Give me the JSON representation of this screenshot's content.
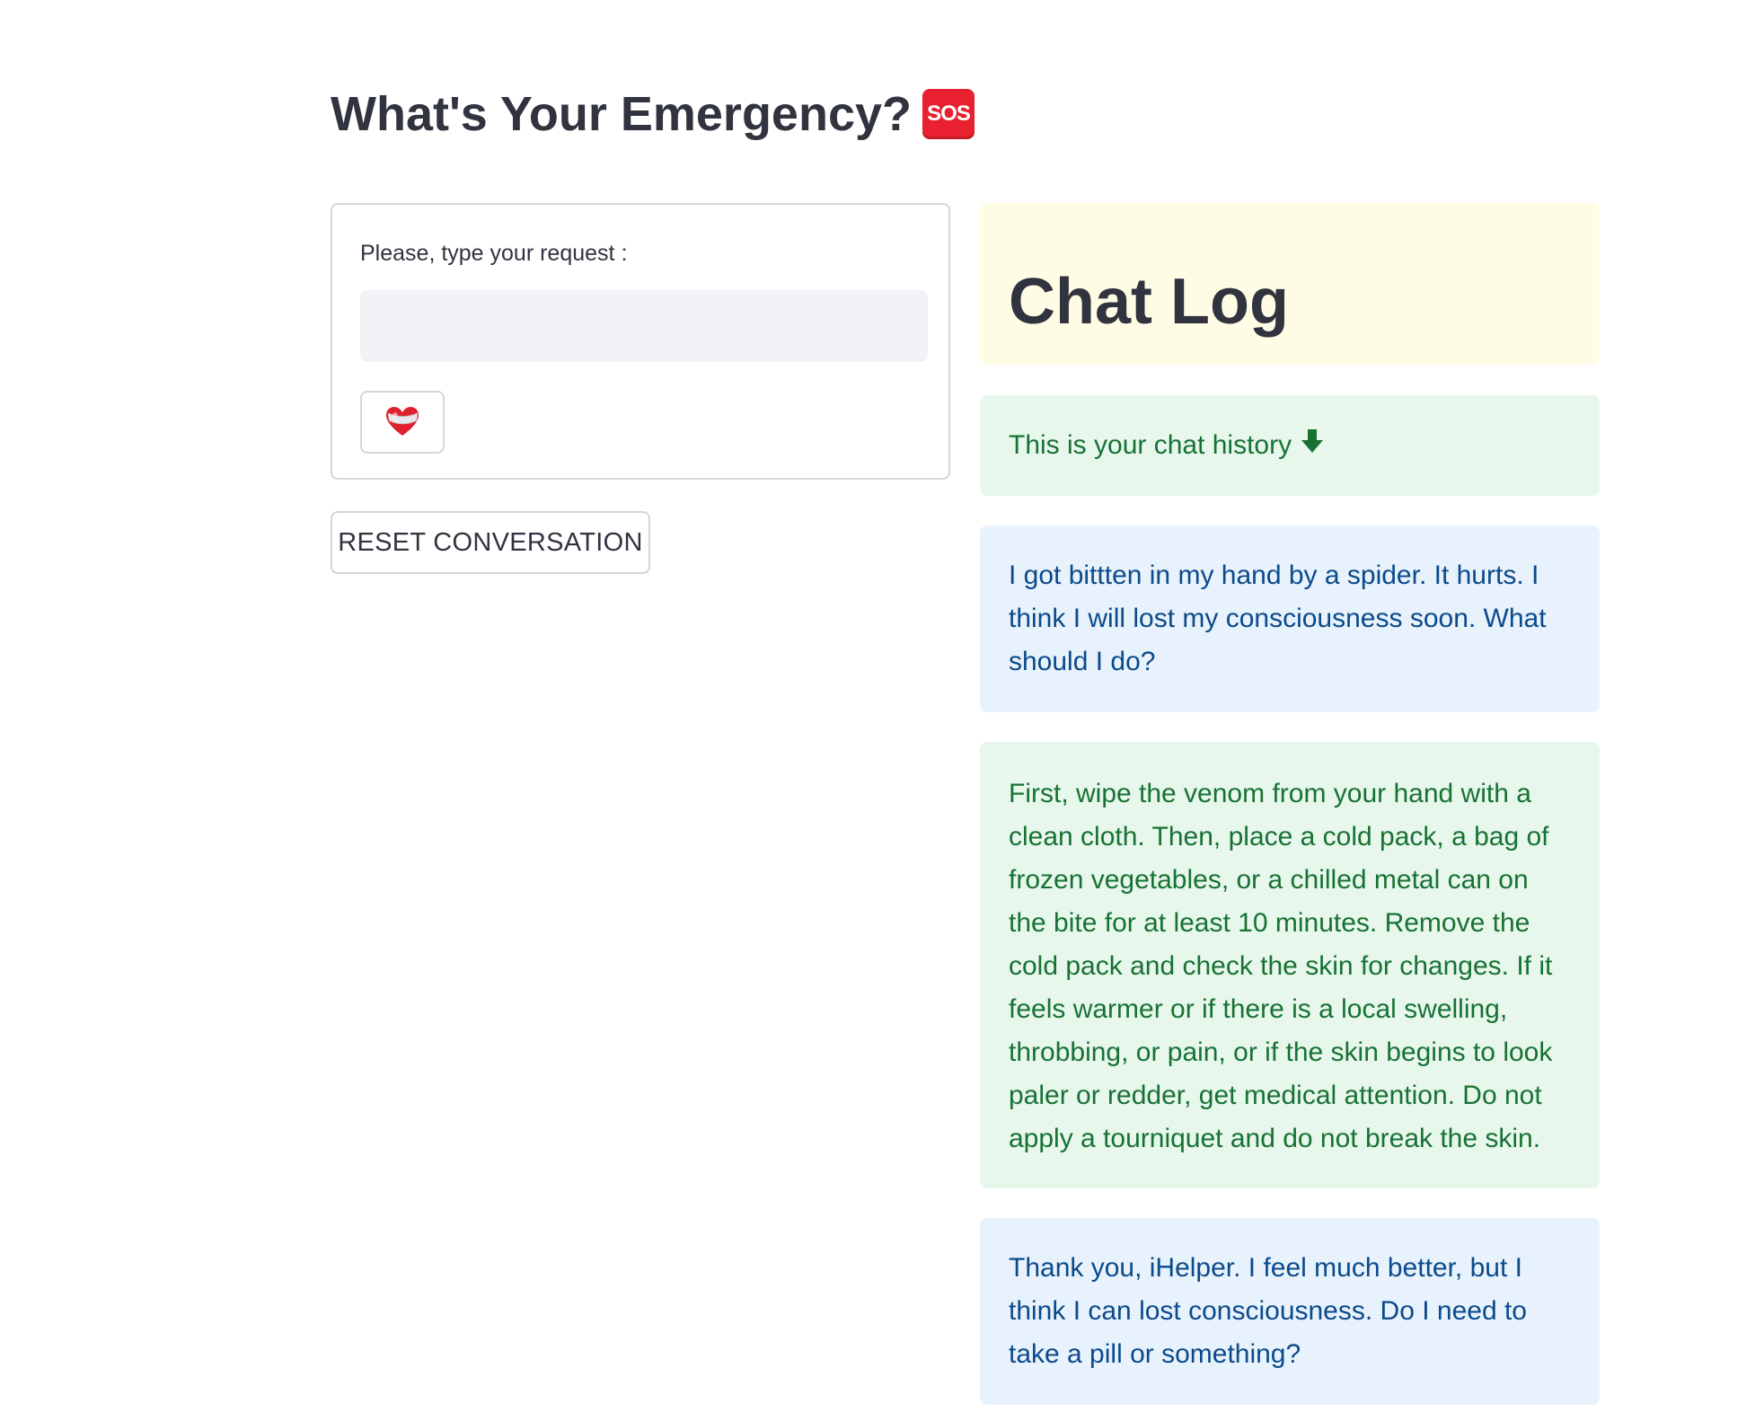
{
  "header": {
    "title": "What's Your Emergency?",
    "title_icon": "sos-icon",
    "title_icon_text": "SOS"
  },
  "form": {
    "label": "Please, type your request :",
    "input_value": "",
    "input_placeholder": "",
    "submit_icon": "mending-heart-icon"
  },
  "reset_button": {
    "label": "RESET CONVERSATION"
  },
  "chat_log": {
    "title": "Chat Log",
    "history_label": "This is your chat history",
    "history_icon": "down-arrow-icon",
    "messages": [
      {
        "role": "user",
        "text": "I got bittten in my hand by a spider. It hurts. I think I will lost my consciousness soon. What should I do?"
      },
      {
        "role": "assistant",
        "text": "First, wipe the venom from your hand with a clean cloth. Then, place a cold pack, a bag of frozen vegetables, or a chilled metal can on the bite for at least 10 minutes. Remove the cold pack and check the skin for changes. If it feels warmer or if there is a local swelling, throbbing, or pain, or if the skin begins to look paler or redder, get medical attention. Do not apply a tourniquet and do not break the skin."
      },
      {
        "role": "user",
        "text": "Thank you, iHelper. I feel much better, but I think I can lost consciousness. Do I need to take a pill or something?"
      }
    ]
  },
  "colors": {
    "text": "#31333f",
    "user_bg": "#e8f2fc",
    "user_text": "#0b4a8b",
    "bot_bg": "#e7f7ec",
    "bot_text": "#177233",
    "header_bg": "#fffce6",
    "sos_red": "#e8202f"
  }
}
